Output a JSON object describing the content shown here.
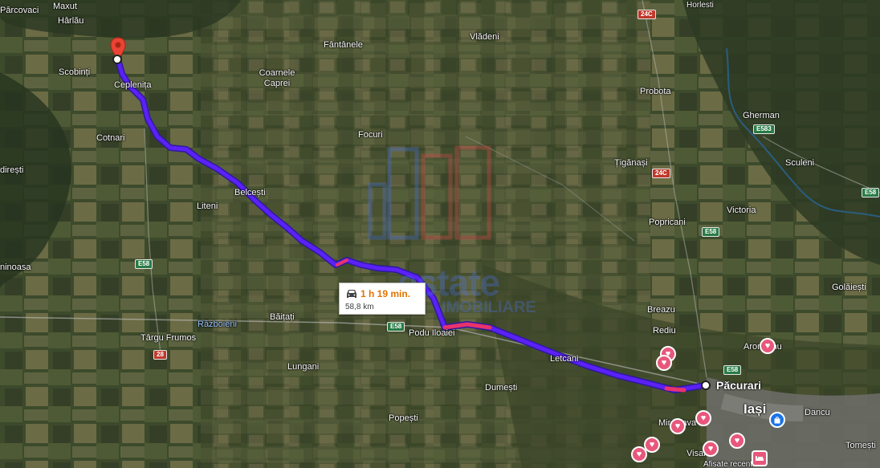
{
  "map": {
    "places": [
      {
        "name": "Pârcovaci"
      },
      {
        "name": "Maxut"
      },
      {
        "name": "Hârlău"
      },
      {
        "name": "Scobinți"
      },
      {
        "name": "Ceplenița"
      },
      {
        "name": "Cotnari"
      },
      {
        "name": "direști"
      },
      {
        "name": "Fântânele"
      },
      {
        "name": "Coarnele Caprei"
      },
      {
        "name": "Vlădeni"
      },
      {
        "name": "Focuri"
      },
      {
        "name": "Belcești"
      },
      {
        "name": "Liteni"
      },
      {
        "name": "Probota"
      },
      {
        "name": "Gherman"
      },
      {
        "name": "Țigănași"
      },
      {
        "name": "Sculeni"
      },
      {
        "name": "Victoria"
      },
      {
        "name": "Popricani"
      },
      {
        "name": "Golăiești"
      },
      {
        "name": "ninoasa"
      },
      {
        "name": "Războieni"
      },
      {
        "name": "Băițați"
      },
      {
        "name": "Târgu Frumos"
      },
      {
        "name": "Podu Iloaiei"
      },
      {
        "name": "Breazu"
      },
      {
        "name": "Rediu"
      },
      {
        "name": "Aroneanu"
      },
      {
        "name": "Lungani"
      },
      {
        "name": "Letcani"
      },
      {
        "name": "Dumești"
      },
      {
        "name": "Păcurari"
      },
      {
        "name": "Iași"
      },
      {
        "name": "Dancu"
      },
      {
        "name": "Popești"
      },
      {
        "name": "Miroslava"
      },
      {
        "name": "Visan"
      },
      {
        "name": "Tomești"
      },
      {
        "name": "Afisate recent"
      },
      {
        "name": "Horlesti"
      }
    ],
    "road_labels": [
      {
        "label": "24C",
        "kind": "n"
      },
      {
        "label": "E583",
        "kind": "e"
      },
      {
        "label": "24C",
        "kind": "n"
      },
      {
        "label": "E58",
        "kind": "e"
      },
      {
        "label": "E58",
        "kind": "e"
      },
      {
        "label": "E58",
        "kind": "e"
      },
      {
        "label": "E58",
        "kind": "e"
      },
      {
        "label": "28",
        "kind": "n"
      },
      {
        "label": "E58",
        "kind": "e"
      }
    ],
    "route": {
      "duration": "1 h 19 min.",
      "distance": "58,8 km",
      "line_color": "#5b21f5",
      "traffic_color": "#e8336b",
      "origin": "Ceplenița",
      "destination": "Păcurari"
    },
    "watermark": {
      "text": "estate",
      "subtext": "IMOBILIARE"
    },
    "icons": {
      "destination_pin": "red-location-pin-icon",
      "route_start": "route-endpoint-icon",
      "car": "car-icon",
      "favorite": "heart-icon",
      "shopping": "shopping-bag-icon",
      "hotel": "hotel-icon"
    }
  }
}
